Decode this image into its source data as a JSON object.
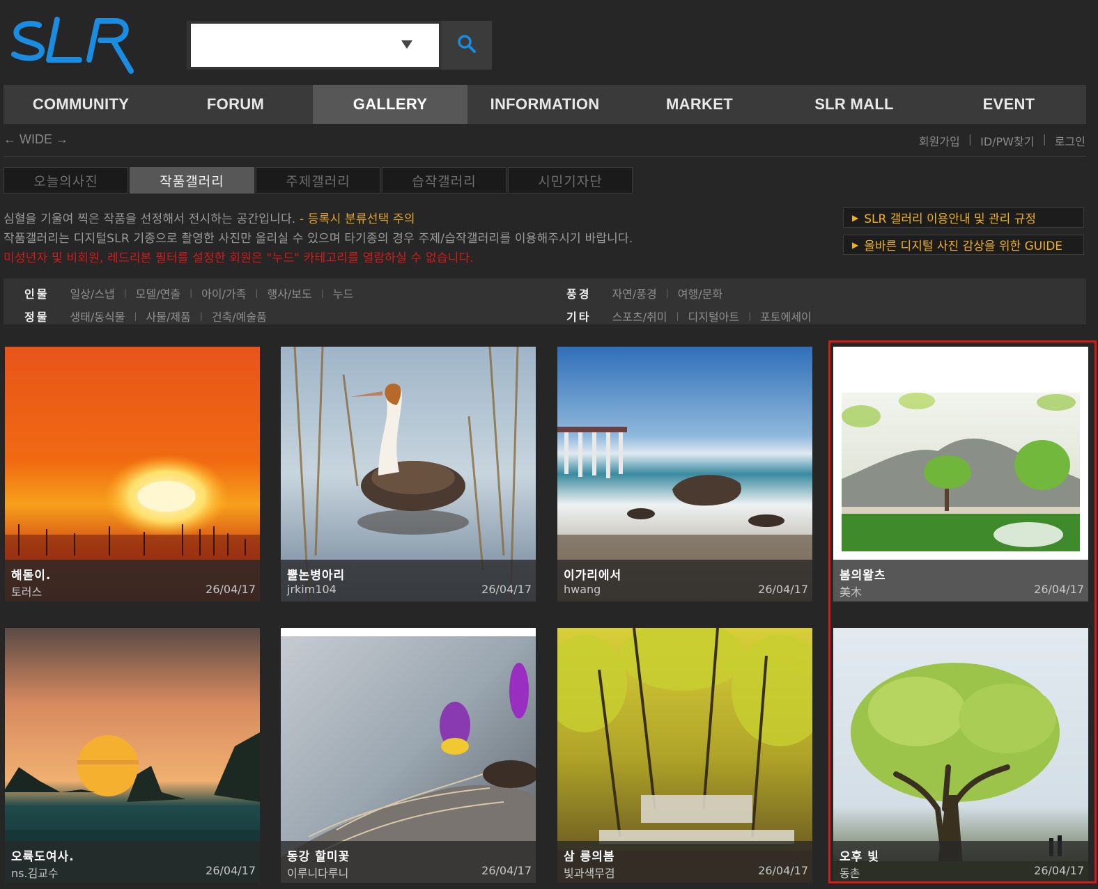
{
  "logo": {
    "text": "SLR",
    "color": "#1a8de0"
  },
  "search": {
    "placeholder": "",
    "value": ""
  },
  "nav": {
    "items": [
      {
        "label": "COMMUNITY",
        "active": false
      },
      {
        "label": "FORUM",
        "active": false
      },
      {
        "label": "GALLERY",
        "active": true
      },
      {
        "label": "INFORMATION",
        "active": false
      },
      {
        "label": "MARKET",
        "active": false
      },
      {
        "label": "SLR MALL",
        "active": false
      },
      {
        "label": "EVENT",
        "active": false
      }
    ]
  },
  "wide": {
    "label": "← WIDE →"
  },
  "user_links": {
    "signup": "회원가입",
    "find_id_pw": "ID/PW찾기",
    "login": "로그인"
  },
  "subtabs": [
    {
      "label": "오늘의사진",
      "active": false
    },
    {
      "label": "작품갤러리",
      "active": true
    },
    {
      "label": "주제갤러리",
      "active": false
    },
    {
      "label": "습작갤러리",
      "active": false
    },
    {
      "label": "시민기자단",
      "active": false
    }
  ],
  "notices": {
    "line1": "심혈을 기울여 찍은 작품을 선정해서 전시하는 공간입니다.",
    "line1_warn": " - 등록시 분류선택 주의",
    "line2": "작품갤러리는 디지털SLR 기종으로 촬영한 사진만 올리실 수 있으며 타기종의 경우 주제/습작갤러리를 이용해주시기 바랍니다.",
    "line3": "미성년자 및 비회원, 레드리본 필터를 설정한 회원은 \"누드\" 카테고리를 열람하실 수 없습니다."
  },
  "guides": {
    "guide1": "SLR 갤러리 이용안내 및 관리 규정",
    "guide2": "올바른 디지털 사진 감상을 위한 GUIDE"
  },
  "categories": {
    "people": {
      "head": "인물",
      "links": [
        "일상/스냅",
        "모델/연출",
        "아이/가족",
        "행사/보도",
        "누드"
      ]
    },
    "landscape": {
      "head": "풍경",
      "links": [
        "자연/풍경",
        "여행/문화"
      ]
    },
    "still": {
      "head": "정물",
      "links": [
        "생태/동식물",
        "사물/제품",
        "건축/예술품"
      ]
    },
    "etc": {
      "head": "기타",
      "links": [
        "스포츠/취미",
        "디지털아트",
        "포토에세이"
      ]
    }
  },
  "gallery": [
    {
      "title": "해돋이.",
      "author": "토러스",
      "date": "26/04/17"
    },
    {
      "title": "뿔논병아리",
      "author": "jrkim104",
      "date": "26/04/17"
    },
    {
      "title": "이가리에서",
      "author": "hwang",
      "date": "26/04/17"
    },
    {
      "title": "봄의왈츠",
      "author": "美木",
      "date": "26/04/17"
    },
    {
      "title": "오륙도여사.",
      "author": "ns.김교수",
      "date": "26/04/17"
    },
    {
      "title": "동강 할미꽃",
      "author": "이루니다루니",
      "date": "26/04/17"
    },
    {
      "title": "삼 릉의봄",
      "author": "빛과색무겸",
      "date": "26/04/17"
    },
    {
      "title": "오후 빛",
      "author": "동촌",
      "date": "26/04/17"
    }
  ],
  "colors": {
    "accent_warn": "#e0a52a",
    "alert_red": "#d01c1c",
    "highlight_border": "#d51a1a"
  }
}
